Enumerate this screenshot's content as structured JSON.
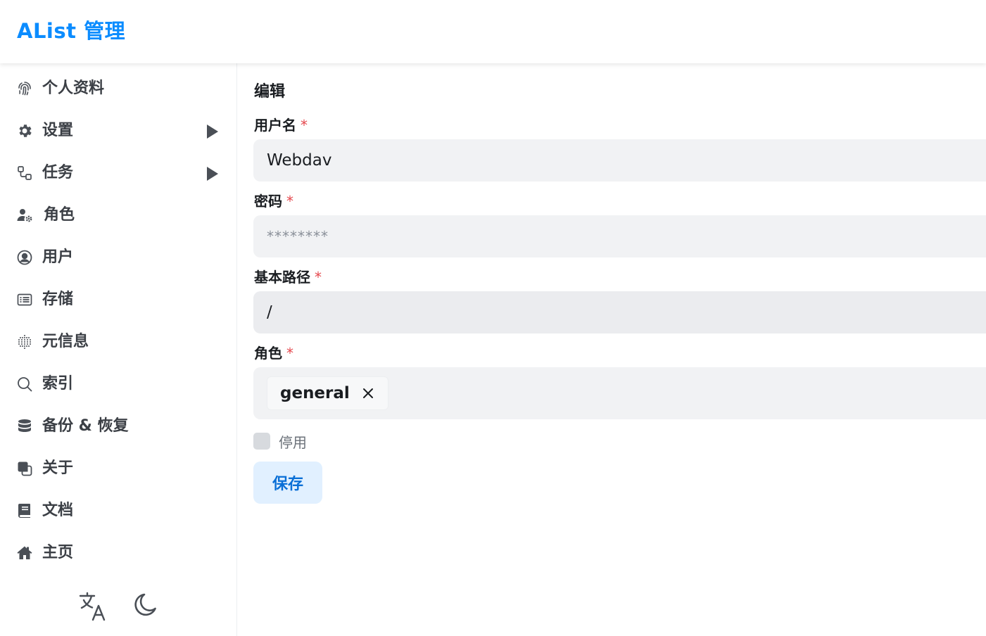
{
  "header": {
    "title": "AList 管理"
  },
  "sidebar": {
    "items": [
      {
        "label": "个人资料",
        "icon": "fingerprint-icon"
      },
      {
        "label": "设置",
        "icon": "gear-icon",
        "expandable": true
      },
      {
        "label": "任务",
        "icon": "workflow-icon",
        "expandable": true
      },
      {
        "label": "角色",
        "icon": "user-gear-icon"
      },
      {
        "label": "用户",
        "icon": "user-circle-icon"
      },
      {
        "label": "存储",
        "icon": "storage-icon"
      },
      {
        "label": "元信息",
        "icon": "metadata-icon"
      },
      {
        "label": "索引",
        "icon": "search-icon"
      },
      {
        "label": "备份 & 恢复",
        "icon": "database-icon"
      },
      {
        "label": "关于",
        "icon": "copy-icon"
      },
      {
        "label": "文档",
        "icon": "book-icon"
      },
      {
        "label": "主页",
        "icon": "home-icon"
      }
    ],
    "tools": [
      {
        "name": "language",
        "icon": "translate-icon"
      },
      {
        "name": "theme",
        "icon": "moon-icon"
      }
    ]
  },
  "form": {
    "title": "编辑",
    "username": {
      "label": "用户名",
      "required": "*",
      "value": "Webdav"
    },
    "password": {
      "label": "密码",
      "required": "*",
      "placeholder": "********"
    },
    "base_path": {
      "label": "基本路径",
      "required": "*",
      "value": "/"
    },
    "role": {
      "label": "角色",
      "required": "*",
      "tags": [
        "general"
      ]
    },
    "disabled": {
      "label": "停用",
      "checked": false
    },
    "save_label": "保存"
  },
  "colors": {
    "brand": "#0b8cff",
    "required": "#e5484d",
    "save_bg": "#e1f0ff",
    "save_text": "#0a6fd6"
  }
}
